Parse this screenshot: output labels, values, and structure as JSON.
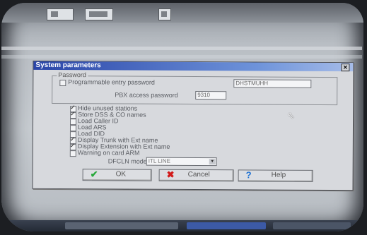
{
  "dialog": {
    "title": "System parameters",
    "close_glyph": "✕",
    "group": {
      "legend": "Password",
      "program_entry": {
        "label": "Programmable entry password",
        "checked": false,
        "value": "DHSTMUHH"
      },
      "pbx_access": {
        "label": "PBX access password",
        "value": "9310"
      }
    },
    "options": [
      {
        "label": "Hide unused stations",
        "checked": true
      },
      {
        "label": "Store DSS & CO names",
        "checked": true
      },
      {
        "label": "Load Caller ID",
        "checked": false
      },
      {
        "label": "Load ARS",
        "checked": false
      },
      {
        "label": "Load DID",
        "checked": false
      },
      {
        "label": "Display Trunk with Ext name",
        "checked": true
      },
      {
        "label": "Display Extension with Ext name",
        "checked": true
      },
      {
        "label": "Warning on card ARM",
        "checked": false
      }
    ],
    "dial_mode": {
      "label": "DFCLN mode",
      "value": "ITL LINE"
    },
    "buttons": {
      "ok": "OK",
      "cancel": "Cancel",
      "help": "Help"
    }
  },
  "colors": {
    "titlebar": "#2a45a8",
    "ok_icon": "#27a83a",
    "cancel_icon": "#d21a1a",
    "help_icon": "#1a6fd2"
  }
}
